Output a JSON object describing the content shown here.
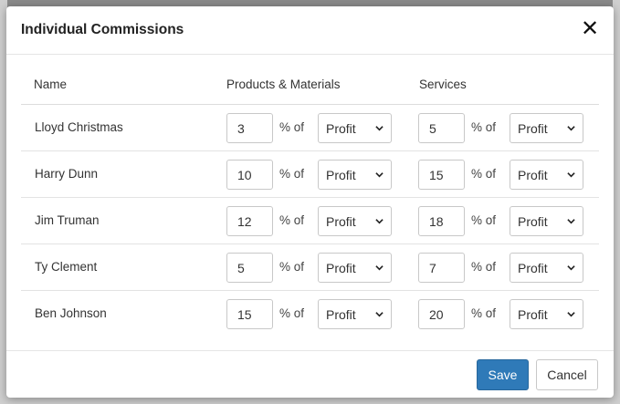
{
  "modal": {
    "title": "Individual Commissions",
    "close_label": "✕"
  },
  "table": {
    "headers": {
      "name": "Name",
      "products": "Products & Materials",
      "services": "Services"
    },
    "pct_label": "% of",
    "rows": [
      {
        "name": "Lloyd Christmas",
        "products_value": "3",
        "products_basis": "Profit",
        "services_value": "5",
        "services_basis": "Profit"
      },
      {
        "name": "Harry Dunn",
        "products_value": "10",
        "products_basis": "Profit",
        "services_value": "15",
        "services_basis": "Profit"
      },
      {
        "name": "Jim Truman",
        "products_value": "12",
        "products_basis": "Profit",
        "services_value": "18",
        "services_basis": "Profit"
      },
      {
        "name": "Ty Clement",
        "products_value": "5",
        "products_basis": "Profit",
        "services_value": "7",
        "services_basis": "Profit"
      },
      {
        "name": "Ben Johnson",
        "products_value": "15",
        "products_basis": "Profit",
        "services_value": "20",
        "services_basis": "Profit"
      }
    ]
  },
  "footer": {
    "save_label": "Save",
    "cancel_label": "Cancel"
  },
  "colors": {
    "primary": "#2f7ab8",
    "border": "#c8c8c8"
  }
}
